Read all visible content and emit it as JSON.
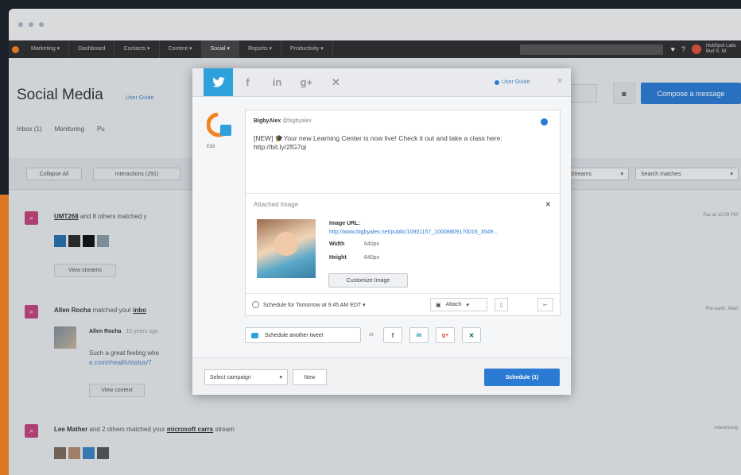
{
  "chrome": {
    "dots": 3
  },
  "appnav": {
    "items": [
      "Marketing ▾",
      "Dashboard",
      "Contacts ▾",
      "Content ▾",
      "Social ▾",
      "Reports ▾",
      "Productivity ▾"
    ],
    "active_index": 4,
    "account": [
      "HubSpot Labs",
      "Bud S. W."
    ]
  },
  "page": {
    "title": "Social Media",
    "link": "User Guide",
    "compose_label": "Compose a message",
    "tabs": [
      "Inbox (1)",
      "Monitoring",
      "Pu"
    ]
  },
  "filters": {
    "collapse": "Collapse All",
    "interactions": "Interactions (291)",
    "select1": "Streams",
    "select2": "Search matches"
  },
  "stream": [
    {
      "lead": "UMT268",
      "rest": " and 8 others matched y",
      "time": "Tue at 12:09 PM",
      "button": "View streams"
    },
    {
      "lead": "Allen Rocha",
      "rest": " matched your ",
      "link2": "inbo",
      "time": "Pre-earth, Wed",
      "sub_name": "Allen Rocha",
      "sub_time": "10 years ago",
      "sub_text": "Such a great feeling whe",
      "sub_link": "e.com/rhealth/status/7",
      "button": "View context"
    },
    {
      "lead": "Lee Mather",
      "rest": " and 2 others matched your ",
      "link2": "microsoft carrs",
      "rest2": " stream",
      "time": "Advertising"
    }
  ],
  "modal": {
    "user_guide": "User Guide",
    "profile_label": "Edit",
    "handle_name": "BigbyAlex",
    "handle_at": "@bigbyalex",
    "tweet": "[NEW] 🎓Your new Learning Center is now live! Check it out and take a class here: http://bit.ly/2fG7qi",
    "attached_title": "Attached Image",
    "image_url_label": "Image URL:",
    "image_url": "http://www.bigbyalex.net/public/10801157_10008809170016_3549...",
    "width_label": "Width",
    "width_value": "640px",
    "height_label": "Height",
    "height_value": "640px",
    "customize_label": "Customize Image",
    "schedule_text": "Schedule for Tomorrow at 9:45 AM EDT ▾",
    "attach_label": "Attach",
    "another_label": "Schedule another tweet",
    "or_label": "or",
    "campaign_label": "Select campaign",
    "new_label": "New",
    "schedule_button": "Schedule (1)"
  },
  "colors": {
    "accent": "#2b7bd4",
    "twitter": "#2ea1dd",
    "stream_icon": "#c0457c",
    "orange": "#f58220"
  }
}
